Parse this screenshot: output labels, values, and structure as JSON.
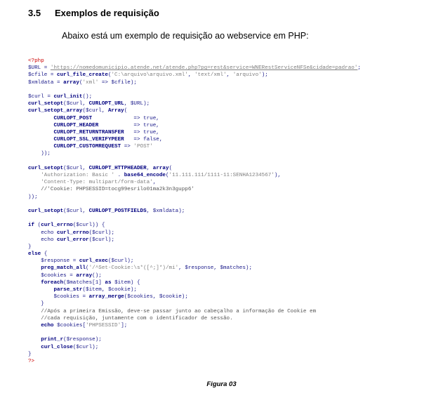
{
  "section": {
    "number": "3.5",
    "title": "Exemplos de requisição"
  },
  "intro": "Abaixo está um exemplo de requisição ao webservice em PHP:",
  "code_lines": [
    "<?php",
    "$URL = 'https://nomedomunicipio.atende.net/atende.php?pg=rest&service=WNERestServiceNFSe&cidade=padrao';",
    "$cfile = curl_file_create('C:\\arquivo\\arquivo.xml', 'text/xml', 'arquivo');",
    "$xmldata = array('xml' => $cfile);",
    "",
    "$curl = curl_init();",
    "curl_setopt($curl, CURLOPT_URL, $URL);",
    "curl_setopt_array($curl, Array(",
    "        CURLOPT_POST             => true,",
    "        CURLOPT_HEADER           => true,",
    "        CURLOPT_RETURNTRANSFER   => true,",
    "        CURLOPT_SSL_VERIFYPEER   => false,",
    "        CURLOPT_CUSTOMREQUEST => 'POST'",
    "    ));",
    "",
    "curl_setopt($curl, CURLOPT_HTTPHEADER, array(",
    "    'Authorization: Basic ' . base64_encode('11.111.111/1111-11:SENHA1234567'),",
    "    'Content-Type: multipart/form-data',",
    "    //'Cookie: PHPSESSID=tocg99esrilo01ma2k3n3gupp6'",
    "));",
    "",
    "curl_setopt($curl, CURLOPT_POSTFIELDS, $xmldata);",
    "",
    "if (curl_errno($curl)) {",
    "    echo curl_errno($curl);",
    "    echo curl_error($curl);",
    "}",
    "else {",
    "    $response = curl_exec($curl);",
    "    preg_match_all('/^Set-Cookie:\\s*([^;]*)/mi', $response, $matches);",
    "    $cookies = array();",
    "    foreach($matches[1] as $item) {",
    "        parse_str($item, $cookie);",
    "        $cookies = array_merge($cookies, $cookie);",
    "    }",
    "    //Após a primeira Emissão, deve-se passar junto ao cabeçalho a informação de Cookie em",
    "    //cada requisição, juntamente com o identificador de sessão.",
    "    echo $cookies['PHPSESSID'];",
    "",
    "    print_r($response);",
    "    curl_close($curl);",
    "}",
    "?>"
  ],
  "caption": "Figura 03",
  "colors": {
    "php_tag": "#cc0000",
    "code_text": "#1a1a8a",
    "function": "#000080",
    "string": "#7f7f7f",
    "comment": "#555555"
  }
}
